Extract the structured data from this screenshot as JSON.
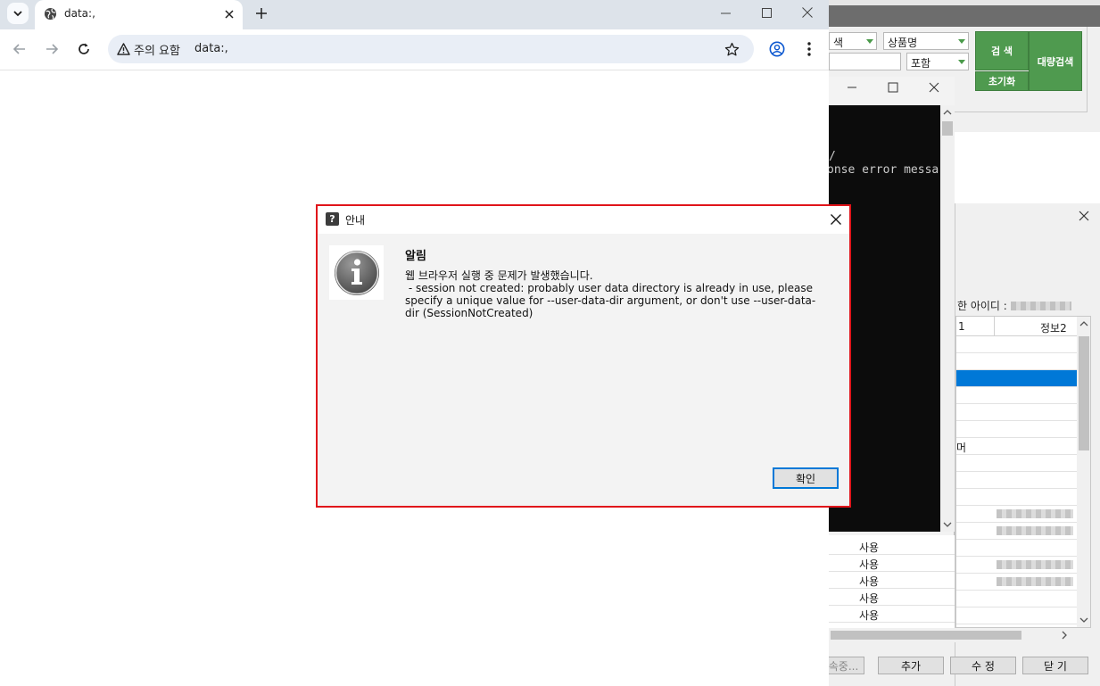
{
  "browser": {
    "tab_title": "data:,",
    "security_label": "주의 요함",
    "url": "data:,"
  },
  "dialog": {
    "title": "안내",
    "heading": "알림",
    "message_line1": "웹 브라우저 실행 중 문제가 발생했습니다.",
    "message_line2": " - session not created: probably user data directory is already in use, please specify a unique value for --user-data-dir argument, or don't use --user-data-dir (SessionNotCreated)",
    "ok_label": "확인"
  },
  "background_app": {
    "combo_partial": "색",
    "combo_product": "상품명",
    "combo_include": "포함",
    "search_label": "검 색",
    "reset_label": "초기화",
    "bulk_search_label": "대량검색",
    "console_line1": "/",
    "console_line2": "onse error messa",
    "id_label": "한 아이디 :",
    "grid_col1": "1",
    "grid_col2": "정보2",
    "grid_partial": "머",
    "use_label": "사용",
    "btn_partial": "속중...",
    "btn_add": "추가",
    "btn_edit": "수 정",
    "btn_close": "닫 기"
  },
  "colors": {
    "dialog_border": "#e0141a",
    "accent_blue": "#0078d7",
    "green_button": "#4f9a4f"
  }
}
